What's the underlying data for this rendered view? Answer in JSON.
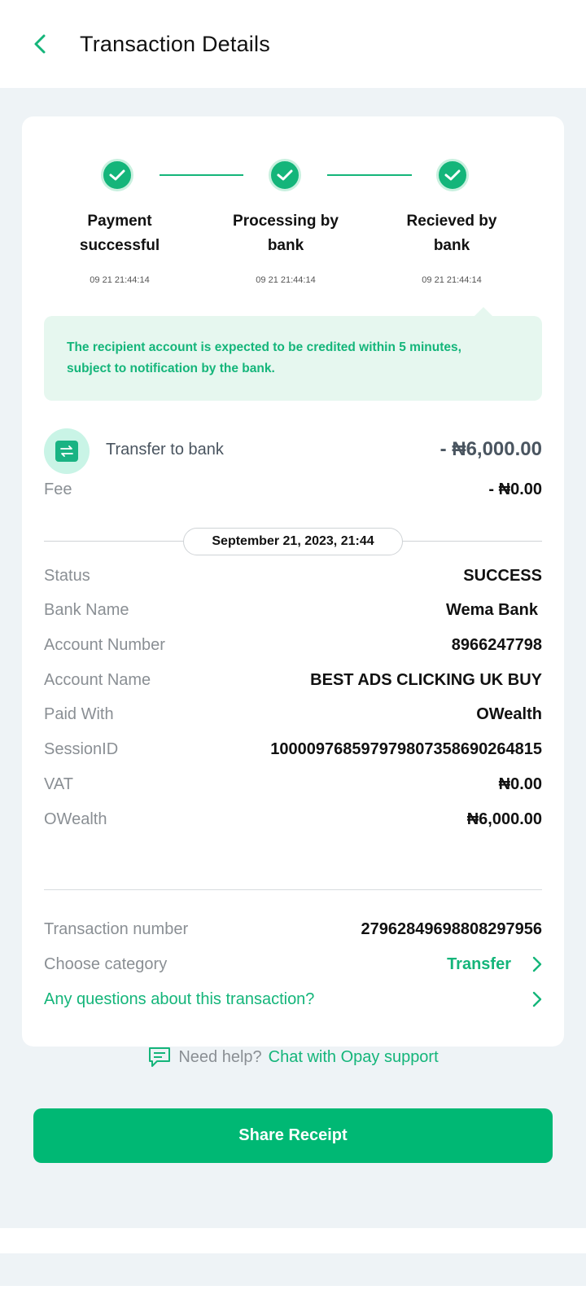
{
  "header": {
    "title": "Transaction Details"
  },
  "steps": [
    {
      "label_line1": "Payment",
      "label_line2": "successful",
      "time": "09 21 21:44:14"
    },
    {
      "label_line1": "Processing by",
      "label_line2": "bank",
      "time": "09 21 21:44:14"
    },
    {
      "label_line1": "Recieved by",
      "label_line2": "bank",
      "time": "09 21 21:44:14"
    }
  ],
  "notice": {
    "line1": "The recipient account is expected to be credited within 5 minutes,",
    "line2": "subject to notification by the bank."
  },
  "transfer": {
    "label": "Transfer to bank",
    "amount": "- ₦6,000.00",
    "fee_label": "Fee",
    "fee_value": "- ₦0.00"
  },
  "date": "September 21, 2023, 21:44",
  "details": [
    {
      "key": "Status",
      "value": "SUCCESS"
    },
    {
      "key": "Bank Name",
      "value": "Wema Bank"
    },
    {
      "key": "Account Number",
      "value": "8966247798"
    },
    {
      "key": "Account Name",
      "value": "BEST ADS CLICKING UK BUY"
    },
    {
      "key": "Paid With",
      "value": "OWealth"
    },
    {
      "key": "SessionID",
      "value": "100009768597979807358690264815"
    },
    {
      "key": "VAT",
      "value": "₦0.00"
    },
    {
      "key": "OWealth",
      "value": "₦6,000.00"
    }
  ],
  "transaction": {
    "number_label": "Transaction number",
    "number_value": "27962849698808297956",
    "category_label": "Choose category",
    "category_value": "Transfer",
    "questions_label": "Any questions about this transaction?"
  },
  "help": {
    "prefix": "Need help?",
    "link": "Chat with Opay support"
  },
  "share_button": "Share Receipt",
  "colors": {
    "accent": "#14b57a",
    "button": "#00b874",
    "background": "#eef3f6"
  }
}
